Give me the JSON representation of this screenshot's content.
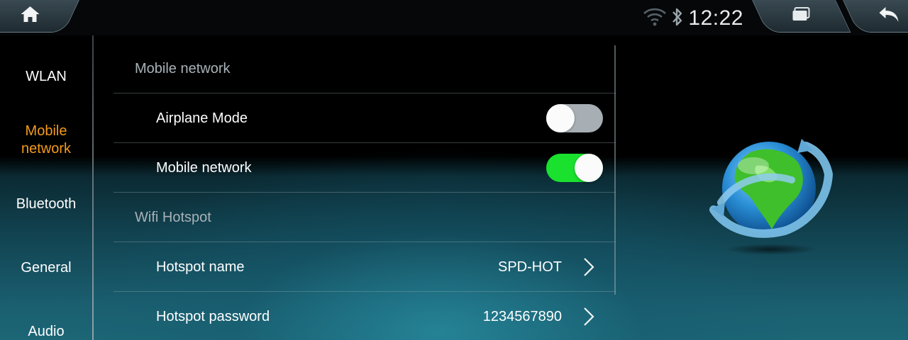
{
  "statusbar": {
    "time": "12:22",
    "icons": [
      "home-icon",
      "wifi-icon",
      "bluetooth-icon",
      "recent-apps-icon",
      "back-icon"
    ]
  },
  "sidebar": {
    "items": [
      {
        "label": "WLAN",
        "active": false
      },
      {
        "label": "Mobile network",
        "active": true
      },
      {
        "label": "Bluetooth",
        "active": false
      },
      {
        "label": "General",
        "active": false
      },
      {
        "label": "Audio",
        "active": false
      }
    ]
  },
  "main": {
    "sections": [
      {
        "title": "Mobile network",
        "rows": [
          {
            "label": "Airplane Mode",
            "toggle": false
          },
          {
            "label": "Mobile network",
            "toggle": true
          }
        ]
      },
      {
        "title": "Wifi Hotspot",
        "rows": [
          {
            "label": "Hotspot name",
            "value": "SPD-HOT"
          },
          {
            "label": "Hotspot password",
            "value": "1234567890"
          }
        ]
      }
    ]
  },
  "colors": {
    "active_accent": "#f39a1c",
    "toggle_on": "#19e12d",
    "toggle_off": "#a7afb4"
  },
  "illustration": "globe-icon"
}
